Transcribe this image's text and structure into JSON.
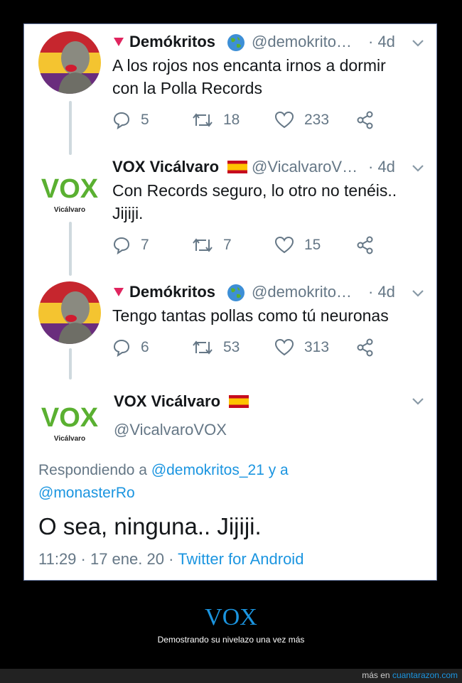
{
  "tweets": [
    {
      "name": "Demókritos",
      "handle": "@demokrito…",
      "time": "· 4d",
      "text": "A los rojos nos encanta irnos a dormir\ncon la Polla Records",
      "replies": "5",
      "retweets": "18",
      "likes": "233"
    },
    {
      "name": "VOX Vicálvaro",
      "handle": "@VicalvaroV…",
      "time": "· 4d",
      "text": "Con Records seguro, lo otro no tenéis..\nJijiji.",
      "replies": "7",
      "retweets": "7",
      "likes": "15"
    },
    {
      "name": "Demókritos",
      "handle": "@demokrito…",
      "time": "· 4d",
      "text": "Tengo tantas pollas como tú neuronas",
      "replies": "6",
      "retweets": "53",
      "likes": "313"
    }
  ],
  "main_tweet": {
    "name": "VOX Vicálvaro",
    "handle": "@VicalvaroVOX",
    "replying_prefix": "Respondiendo a",
    "replying_user1": "@demokritos_21",
    "replying_and": "y a",
    "replying_user2": "@monasterRo",
    "text": "O sea, ninguna.. Jijiji.",
    "timestamp": "11:29 · 17 ene. 20 ·",
    "source": "Twitter for Android"
  },
  "vox_logo": {
    "word": "VOX",
    "sub": "Vicálvaro"
  },
  "caption": {
    "title": "VOX",
    "subtitle": "Demostrando su nivelazo una vez más"
  },
  "footer": {
    "prefix": "más en",
    "site": "cuantarazon.com"
  },
  "colors": {
    "link": "#1b95e0",
    "vox_green": "#5ab031",
    "secondary_text": "#657786"
  }
}
